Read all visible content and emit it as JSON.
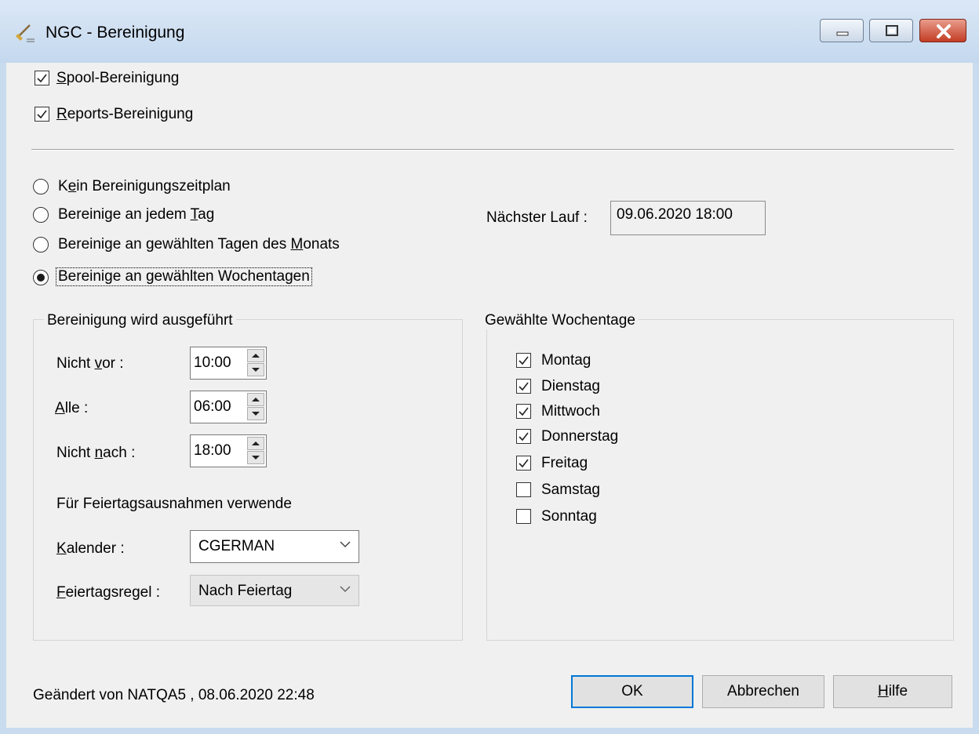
{
  "window": {
    "title": "NGC - Bereinigung",
    "icon": "broom-icon",
    "controls": [
      "minimize-icon",
      "maximize-icon",
      "close-icon"
    ]
  },
  "options": {
    "spool": {
      "label_pre": "",
      "label_key": "S",
      "label_post": "pool-Bereinigung",
      "checked": true
    },
    "reports": {
      "label_pre": "",
      "label_key": "R",
      "label_post": "eports-Bereinigung",
      "checked": true
    }
  },
  "schedule": {
    "radios": [
      {
        "label_pre": "K",
        "label_key": "e",
        "label_post": "in Bereinigungszeitplan",
        "selected": false
      },
      {
        "label_pre": "Bereinige an jedem ",
        "label_key": "T",
        "label_post": "ag",
        "selected": false
      },
      {
        "label_pre": "Bereinige an gewählten Tagen des ",
        "label_key": "M",
        "label_post": "onats",
        "selected": false
      },
      {
        "label_pre": "Bereinige an gewählten Wochentagen",
        "label_key": "",
        "label_post": "",
        "selected": true
      }
    ],
    "next_run_label": "Nächster Lauf :",
    "next_run_value": "09.06.2020   18:00"
  },
  "execution": {
    "group_title": "Bereinigung wird ausgeführt",
    "not_before": {
      "label_pre": "Nicht ",
      "label_key": "v",
      "label_post": "or :",
      "value": "10:00"
    },
    "every": {
      "label_pre": "",
      "label_key": "A",
      "label_post": "lle :",
      "value": "06:00"
    },
    "not_after": {
      "label_pre": "Nicht ",
      "label_key": "n",
      "label_post": "ach :",
      "value": "18:00"
    },
    "holiday_heading": "Für Feiertagsausnahmen verwende",
    "calendar": {
      "label_pre": "",
      "label_key": "K",
      "label_post": "alender :",
      "value": "CGERMAN"
    },
    "holiday_rule": {
      "label_pre": "",
      "label_key": "F",
      "label_post": "eiertagsregel :",
      "value": "Nach Feiertag"
    }
  },
  "weekdays": {
    "group_title": "Gewählte Wochentage",
    "days": [
      {
        "label": "Montag",
        "checked": true
      },
      {
        "label": "Dienstag",
        "checked": true
      },
      {
        "label": "Mittwoch",
        "checked": true
      },
      {
        "label": "Donnerstag",
        "checked": true
      },
      {
        "label": "Freitag",
        "checked": true
      },
      {
        "label": "Samstag",
        "checked": false
      },
      {
        "label": "Sonntag",
        "checked": false
      }
    ]
  },
  "footer": {
    "modified_text": "Geändert von NATQA5 , 08.06.2020 22:48",
    "ok_label": "OK",
    "cancel_label": "Abbrechen",
    "help_label_pre": "",
    "help_label_key": "H",
    "help_label_post": "ilfe"
  },
  "colors": {
    "frame": "#c9dcef",
    "client": "#f0f0f0",
    "default_button_border": "#0078d7",
    "close_button": "#c23d24"
  }
}
